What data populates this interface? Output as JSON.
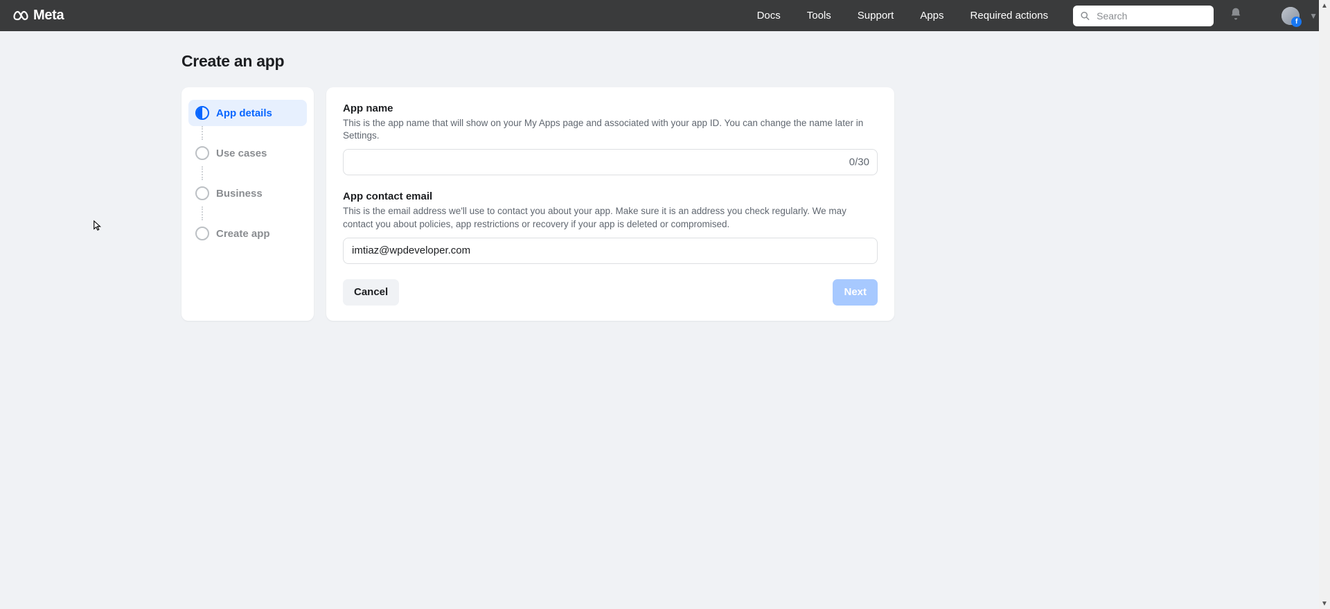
{
  "header": {
    "brand": "Meta",
    "nav": [
      "Docs",
      "Tools",
      "Support",
      "Apps",
      "Required actions"
    ],
    "search_placeholder": "Search",
    "search_value": ""
  },
  "page": {
    "title": "Create an app"
  },
  "steps": [
    {
      "label": "App details",
      "active": true
    },
    {
      "label": "Use cases",
      "active": false
    },
    {
      "label": "Business",
      "active": false
    },
    {
      "label": "Create app",
      "active": false
    }
  ],
  "form": {
    "app_name": {
      "label": "App name",
      "help": "This is the app name that will show on your My Apps page and associated with your app ID. You can change the name later in Settings.",
      "value": "",
      "count": "0/30"
    },
    "contact_email": {
      "label": "App contact email",
      "help": "This is the email address we'll use to contact you about your app. Make sure it is an address you check regularly. We may contact you about policies, app restrictions or recovery if your app is deleted or compromised.",
      "value": "imtiaz@wpdeveloper.com"
    },
    "buttons": {
      "cancel": "Cancel",
      "next": "Next"
    }
  }
}
